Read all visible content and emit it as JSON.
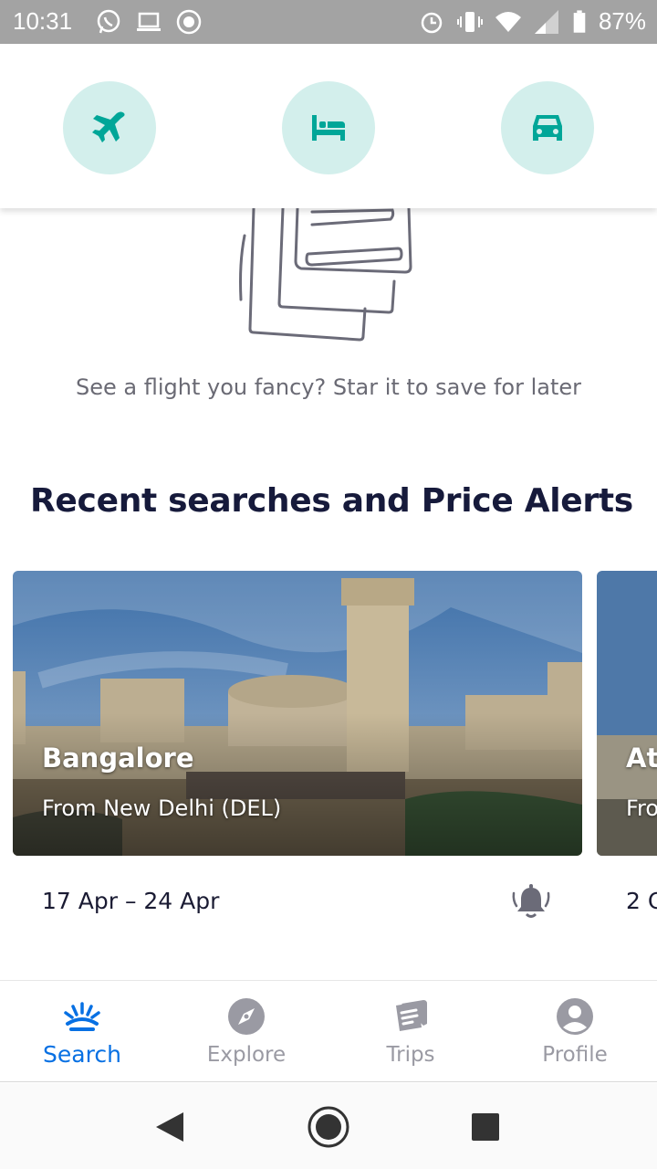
{
  "status_bar": {
    "time": "10:31",
    "battery": "87%",
    "left_icons": [
      "whatsapp-icon",
      "laptop-icon",
      "sync-icon"
    ],
    "right_icons": [
      "alarm-icon",
      "vibrate-icon",
      "wifi-icon",
      "signal-icon",
      "battery-icon"
    ]
  },
  "categories": [
    {
      "id": "flights",
      "icon": "plane-icon"
    },
    {
      "id": "hotels",
      "icon": "bed-icon"
    },
    {
      "id": "cars",
      "icon": "car-icon"
    }
  ],
  "saved": {
    "empty_message": "See a flight you fancy? Star it to save for later"
  },
  "recent": {
    "title": "Recent searches and Price Alerts",
    "cards": [
      {
        "city": "Bangalore",
        "from": "From New Delhi (DEL)",
        "dates": "17 Apr – 24 Apr",
        "alert_icon": "bell-icon"
      },
      {
        "city": "At",
        "from": "Fro",
        "dates": "2 C"
      }
    ]
  },
  "bottom_nav": {
    "items": [
      {
        "label": "Search",
        "icon": "sunrise-icon",
        "active": true
      },
      {
        "label": "Explore",
        "icon": "compass-icon",
        "active": false
      },
      {
        "label": "Trips",
        "icon": "trips-icon",
        "active": false
      },
      {
        "label": "Profile",
        "icon": "profile-icon",
        "active": false
      }
    ]
  },
  "colors": {
    "accent": "#0770e3",
    "category_circle": "#d3efec",
    "category_icon": "#00a698",
    "title": "#161a3b",
    "status_bar": "#a3a3a3"
  }
}
